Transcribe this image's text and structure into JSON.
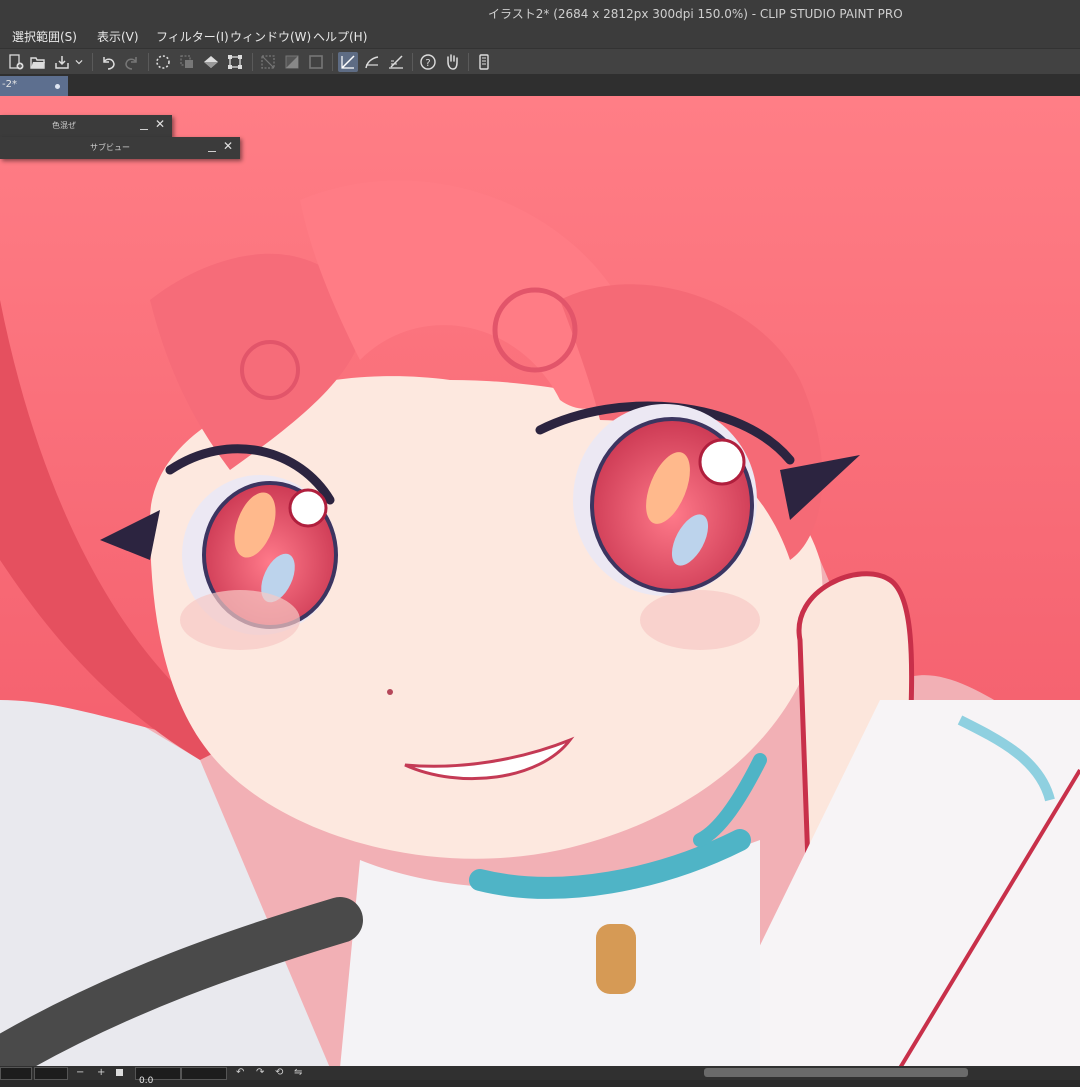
{
  "window": {
    "title": "イラスト2* (2684 x 2812px 300dpi 150.0%)  - CLIP STUDIO PAINT PRO"
  },
  "menu": {
    "items": [
      "選択範囲(S)",
      "表示(V)",
      "フィルター(I)",
      "ウィンドウ(W)",
      "ヘルプ(H)"
    ]
  },
  "toolbar": {
    "icons": [
      "new-file-icon",
      "open-file-icon",
      "save-icon",
      "dropdown-arrow-icon",
      "undo-icon",
      "redo-icon",
      "clear-selection-icon",
      "invert-selection-icon",
      "fill-icon",
      "transform-icon",
      "clear-layer-icon",
      "color-icon",
      "border-icon",
      "snap-to-ruler-icon",
      "snap-to-special-ruler-icon",
      "snap-to-grid-icon",
      "help-icon",
      "hand-icon",
      "device-icon"
    ]
  },
  "document_tab": {
    "label": "-2*"
  },
  "panels": {
    "color_mixing": {
      "title": "色混ぜ"
    },
    "sub_view": {
      "title": "サブビュー"
    }
  },
  "status": {
    "zoom_minus": "−",
    "zoom_plus": "+",
    "angle_value": "0.0"
  },
  "colors": {
    "ui_dark": "#3c3c3c",
    "tab_active": "#5d6f8f",
    "hair": "#f56f78",
    "skin": "#fde8df",
    "eye": "#e24a64"
  }
}
